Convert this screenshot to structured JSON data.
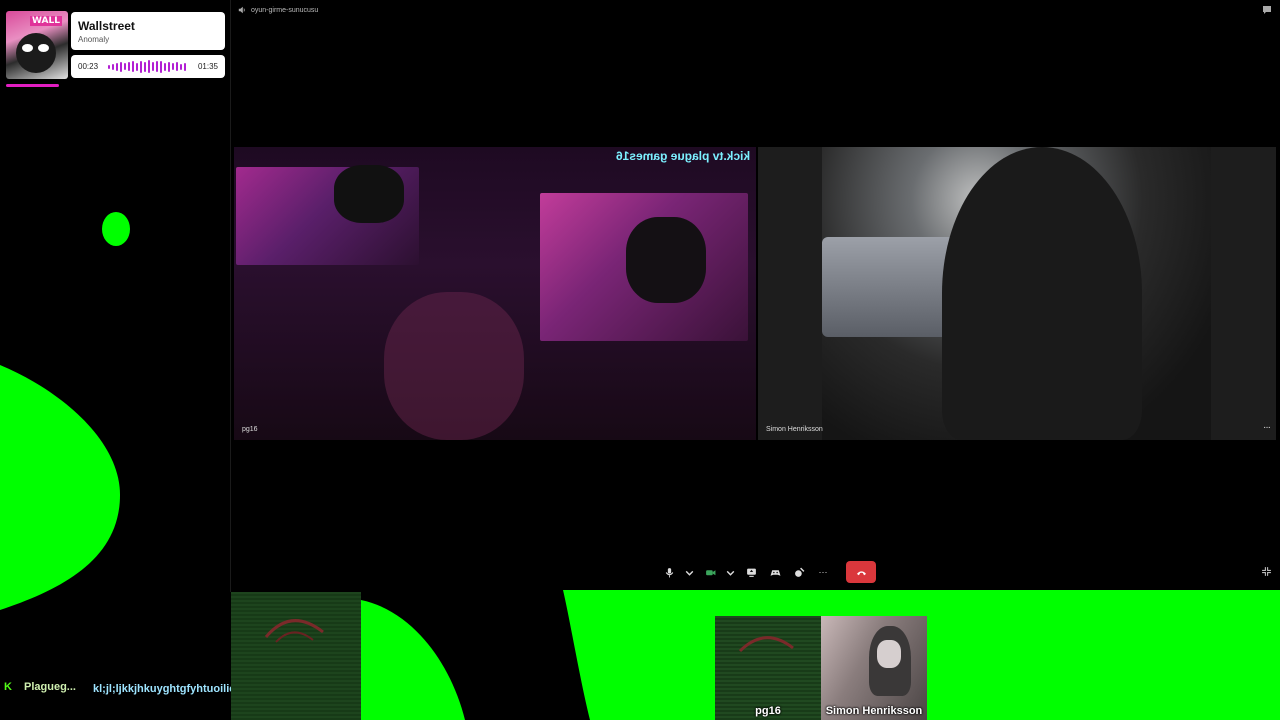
{
  "music": {
    "art_text": "WALL",
    "title": "Wallstreet",
    "artist": "Anomaly",
    "time_current": "00:23",
    "time_total": "01:35",
    "progress": 0.24
  },
  "chat": {
    "username": "Plagueg...",
    "message": "kl;jl;ljkkjhkuyghtgfyhtuoilio;io;oi;"
  },
  "channel": {
    "name": "oyun-girme-sunucusu",
    "icon": "speaker-icon"
  },
  "tiles": [
    {
      "name": "pg16",
      "overlay_text": "kick.tv plague games16"
    },
    {
      "name": "Simon Henriksson",
      "more": "···"
    }
  ],
  "controls": {
    "items": [
      "mic-icon",
      "chevron-icon",
      "camera-icon",
      "chevron-icon",
      "screen-share-icon",
      "activities-icon",
      "soundboard-icon",
      "more-icon",
      "end-call-icon"
    ],
    "more_label": "···"
  },
  "bottom_participants": [
    {
      "name": "pg16"
    },
    {
      "name": "Simon Henriksson"
    }
  ],
  "colors": {
    "green_screen": "#00ff00",
    "end_call": "#da373c",
    "wave": "#b21fd3"
  }
}
